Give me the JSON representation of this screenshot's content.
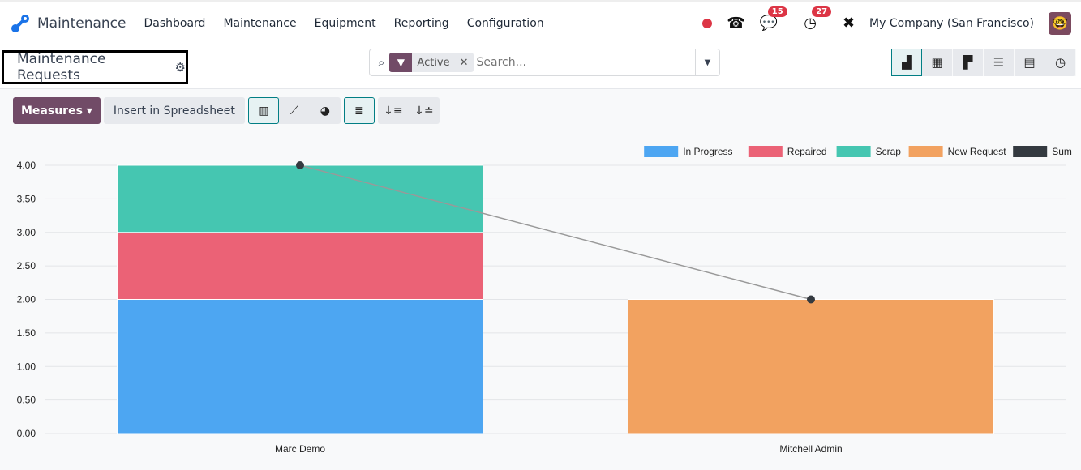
{
  "nav": {
    "app": "Maintenance",
    "menu": [
      "Dashboard",
      "Maintenance",
      "Equipment",
      "Reporting",
      "Configuration"
    ],
    "messages_count": "15",
    "activities_count": "27",
    "company": "My Company (San Francisco)"
  },
  "control": {
    "title": "Maintenance Requests",
    "facet": "Active",
    "search_placeholder": "Search..."
  },
  "toolbar": {
    "measures": "Measures",
    "insert": "Insert in Spreadsheet"
  },
  "chart_data": {
    "type": "bar",
    "stacked": true,
    "categories": [
      "Marc Demo",
      "Mitchell Admin"
    ],
    "series": [
      {
        "name": "In Progress",
        "values": [
          2,
          0
        ],
        "color": "#4da6f2"
      },
      {
        "name": "Repaired",
        "values": [
          1,
          0
        ],
        "color": "#eb6276"
      },
      {
        "name": "Scrap",
        "values": [
          1,
          0
        ],
        "color": "#45c6b1"
      },
      {
        "name": "New Request",
        "values": [
          0,
          2
        ],
        "color": "#f2a260"
      },
      {
        "name": "Sum",
        "values": [
          4,
          2
        ],
        "color": "#343a40",
        "type": "line"
      }
    ],
    "ylim": [
      0,
      4
    ],
    "yticks": [
      "0.00",
      "0.50",
      "1.00",
      "1.50",
      "2.00",
      "2.50",
      "3.00",
      "3.50",
      "4.00"
    ],
    "legend": "top-right",
    "grid": true
  }
}
